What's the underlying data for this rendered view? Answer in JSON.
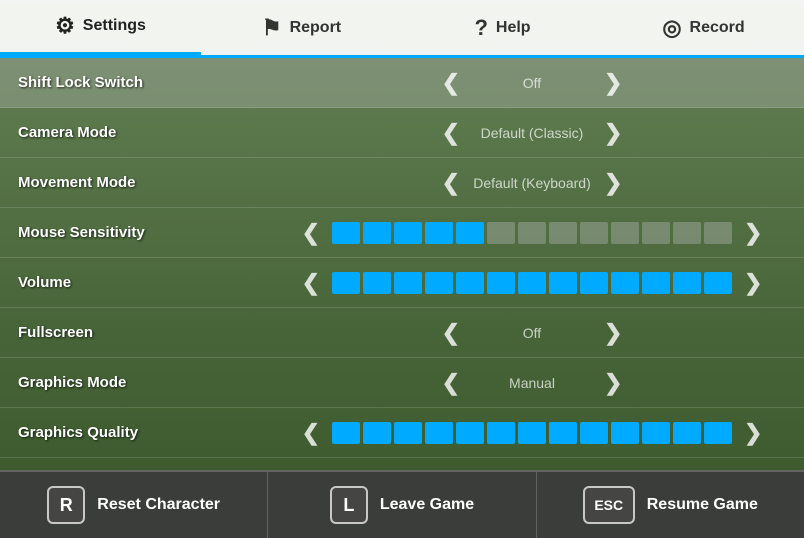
{
  "nav": {
    "items": [
      {
        "id": "settings",
        "label": "Settings",
        "icon": "⚙",
        "active": true
      },
      {
        "id": "report",
        "label": "Report",
        "icon": "⚑",
        "active": false
      },
      {
        "id": "help",
        "label": "Help",
        "icon": "?",
        "active": false
      },
      {
        "id": "record",
        "label": "Record",
        "icon": "◎",
        "active": false
      }
    ]
  },
  "settings": [
    {
      "id": "shift-lock",
      "label": "Shift Lock Switch",
      "type": "toggle",
      "value": "Off",
      "sliderFilled": 0,
      "sliderTotal": 0
    },
    {
      "id": "camera-mode",
      "label": "Camera Mode",
      "type": "toggle",
      "value": "Default (Classic)",
      "sliderFilled": 0,
      "sliderTotal": 0
    },
    {
      "id": "movement-mode",
      "label": "Movement Mode",
      "type": "toggle",
      "value": "Default (Keyboard)",
      "sliderFilled": 0,
      "sliderTotal": 0
    },
    {
      "id": "mouse-sensitivity",
      "label": "Mouse Sensitivity",
      "type": "slider",
      "value": "",
      "sliderFilled": 5,
      "sliderTotal": 13
    },
    {
      "id": "volume",
      "label": "Volume",
      "type": "slider",
      "value": "",
      "sliderFilled": 13,
      "sliderTotal": 13
    },
    {
      "id": "fullscreen",
      "label": "Fullscreen",
      "type": "toggle",
      "value": "Off",
      "sliderFilled": 0,
      "sliderTotal": 0
    },
    {
      "id": "graphics-mode",
      "label": "Graphics Mode",
      "type": "toggle",
      "value": "Manual",
      "sliderFilled": 0,
      "sliderTotal": 0
    },
    {
      "id": "graphics-quality",
      "label": "Graphics Quality",
      "type": "slider",
      "value": "",
      "sliderFilled": 13,
      "sliderTotal": 13
    }
  ],
  "actions": [
    {
      "id": "reset",
      "key": "R",
      "label": "Reset Character"
    },
    {
      "id": "leave",
      "key": "L",
      "label": "Leave Game"
    },
    {
      "id": "resume",
      "key": "ESC",
      "label": "Resume Game"
    }
  ],
  "colors": {
    "accent": "#00aaff",
    "sliderFilled": "#00aaff",
    "sliderEmpty": "rgba(180,180,180,0.4)"
  }
}
